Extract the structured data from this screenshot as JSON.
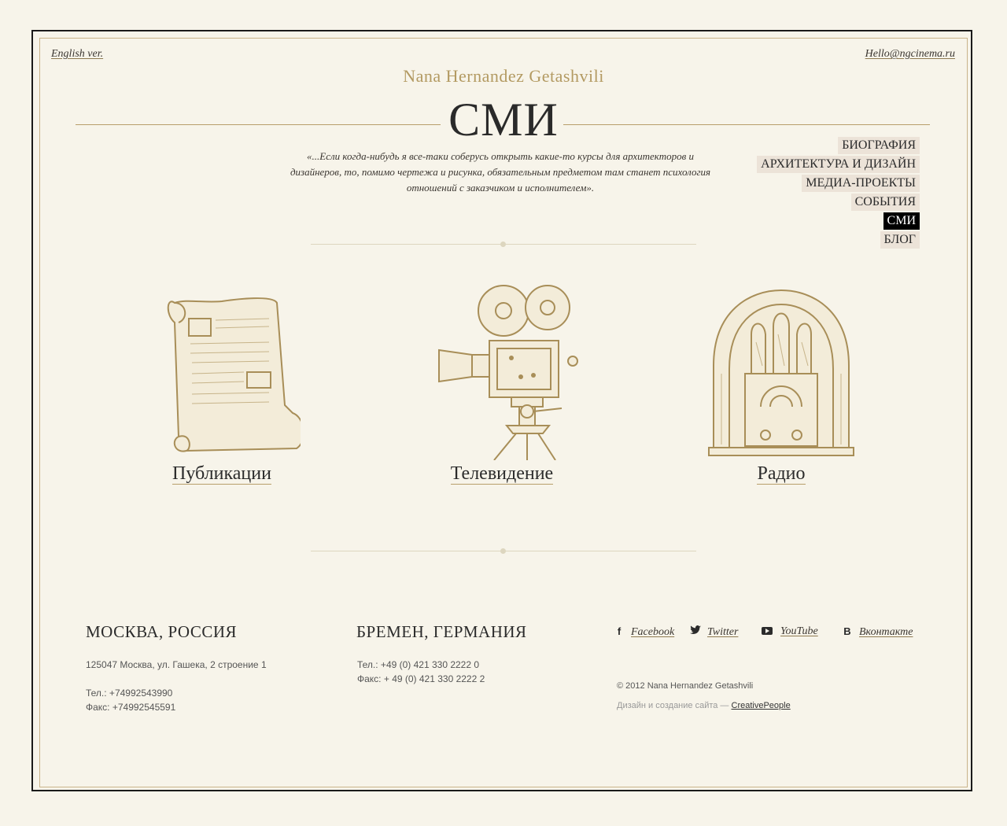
{
  "header": {
    "lang_link": "English ver.",
    "email_link": "Hello@ngcinema.ru",
    "author": "Nana Hernandez Getashvili",
    "page_title": "СМИ",
    "quote": "«...Если когда-нибудь я все-таки соберусь открыть какие-то курсы для архитекторов и дизайнеров, то, помимо чертежа и рисунка, обязательным предметом там станет психология отношений с заказчиком и исполнителем»."
  },
  "nav": {
    "items": [
      {
        "label": "БИОГРАФИЯ",
        "active": false
      },
      {
        "label": "АРХИТЕКТУРА И ДИЗАЙН",
        "active": false
      },
      {
        "label": "МЕДИА-ПРОЕКТЫ",
        "active": false
      },
      {
        "label": "СОБЫТИЯ",
        "active": false
      },
      {
        "label": "СМИ",
        "active": true
      },
      {
        "label": "БЛОГ",
        "active": false
      }
    ]
  },
  "media": [
    {
      "label": "Публикации",
      "icon": "scroll-icon"
    },
    {
      "label": "Телевидение",
      "icon": "film-camera-icon"
    },
    {
      "label": "Радио",
      "icon": "radio-icon"
    }
  ],
  "footer": {
    "moscow": {
      "city": "МОСКВА, РОССИЯ",
      "address": "125047 Москва, ул. Гашека, 2 строение 1",
      "phone": "Тел.: +74992543990",
      "fax": "Факс: +74992545591"
    },
    "bremen": {
      "city": "БРЕМЕН, ГЕРМАНИЯ",
      "phone": "Тел.: +49 (0) 421 330 2222 0",
      "fax": "Факс: + 49 (0) 421 330 2222 2"
    },
    "social": [
      {
        "label": "Facebook",
        "icon": "facebook-icon",
        "glyph": "f"
      },
      {
        "label": "Twitter",
        "icon": "twitter-icon",
        "glyph": "🐦"
      },
      {
        "label": "YouTube",
        "icon": "youtube-icon",
        "glyph": ""
      },
      {
        "label": "Вконтакте",
        "icon": "vk-icon",
        "glyph": "В"
      }
    ],
    "copyright": "© 2012 Nana Hernandez Getashvili",
    "design_text": "Дизайн и создание сайта — ",
    "design_link": "CreativePeople"
  },
  "colors": {
    "background": "#f7f4ea",
    "gold": "#b39a62",
    "frame": "#1a1a1a",
    "nav_bg": "#ece3d8",
    "nav_active": "#000000"
  }
}
